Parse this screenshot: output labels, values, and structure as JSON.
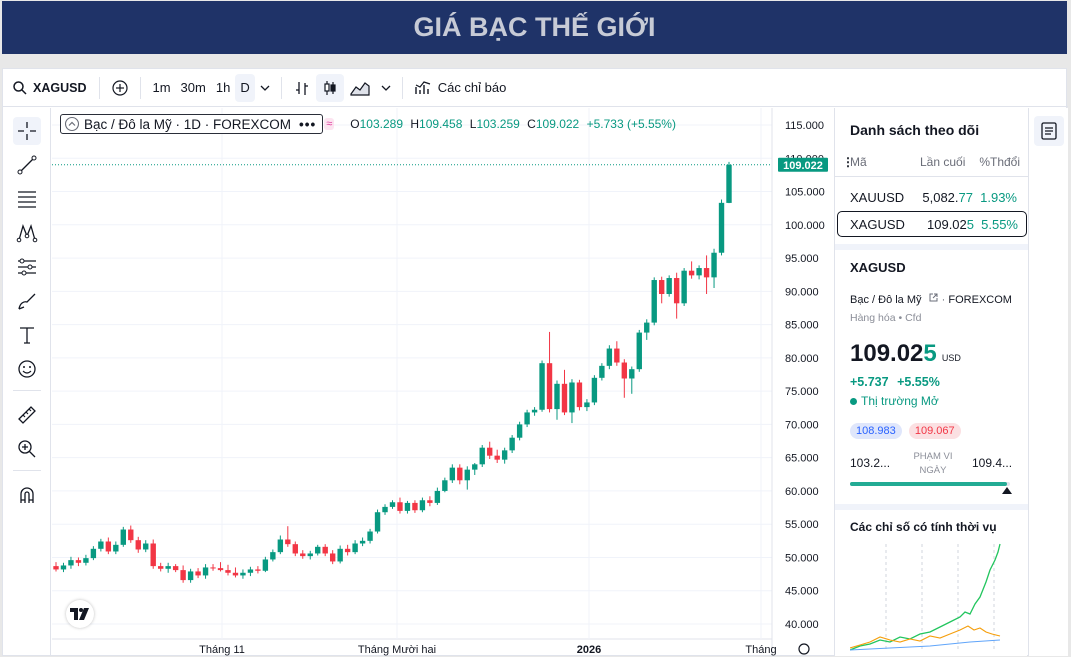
{
  "page": {
    "banner_title": "GIÁ BẠC THẾ GIỚI"
  },
  "toolbar": {
    "symbol": "XAGUSD",
    "intervals": [
      "1m",
      "30m",
      "1h",
      "D"
    ],
    "indicators_label": "Các chỉ báo"
  },
  "legend": {
    "title": "Bạc / Đô la Mỹ · 1D · FOREXCOM",
    "o_label": "O",
    "o": "103.289",
    "h_label": "H",
    "h": "109.458",
    "l_label": "L",
    "l": "103.259",
    "c_label": "C",
    "c": "109.022",
    "change": "+5.733 (+5.55%)"
  },
  "chart_data": {
    "type": "candlestick",
    "symbol": "XAGUSD",
    "ylim": [
      40,
      115
    ],
    "y_ticks": [
      "115.000",
      "110.000",
      "105.000",
      "100.000",
      "95.000",
      "90.000",
      "85.000",
      "80.000",
      "75.000",
      "70.000",
      "65.000",
      "60.000",
      "55.000",
      "50.000",
      "45.000",
      "40.000"
    ],
    "x_ticks": [
      "Tháng 11",
      "Tháng Mười hai",
      "2026",
      "Tháng"
    ],
    "last_price_label": "109.022",
    "last_price": 109.022,
    "colors": {
      "up": "#089981",
      "down": "#f23645"
    },
    "candles": [
      {
        "o": 48.7,
        "h": 49.3,
        "l": 47.9,
        "c": 48.2
      },
      {
        "o": 48.2,
        "h": 49.2,
        "l": 47.8,
        "c": 48.8
      },
      {
        "o": 48.8,
        "h": 50.1,
        "l": 48.3,
        "c": 49.6
      },
      {
        "o": 49.6,
        "h": 50.0,
        "l": 48.7,
        "c": 49.2
      },
      {
        "o": 49.2,
        "h": 50.4,
        "l": 48.8,
        "c": 49.9
      },
      {
        "o": 49.9,
        "h": 51.7,
        "l": 49.6,
        "c": 51.3
      },
      {
        "o": 51.3,
        "h": 52.8,
        "l": 50.9,
        "c": 52.4
      },
      {
        "o": 52.4,
        "h": 53.0,
        "l": 50.5,
        "c": 50.9
      },
      {
        "o": 50.9,
        "h": 52.4,
        "l": 50.5,
        "c": 51.9
      },
      {
        "o": 51.9,
        "h": 54.6,
        "l": 51.6,
        "c": 54.2
      },
      {
        "o": 54.2,
        "h": 54.8,
        "l": 52.2,
        "c": 52.6
      },
      {
        "o": 52.6,
        "h": 53.1,
        "l": 50.7,
        "c": 51.2
      },
      {
        "o": 51.2,
        "h": 52.6,
        "l": 50.8,
        "c": 52.1
      },
      {
        "o": 52.1,
        "h": 52.7,
        "l": 48.3,
        "c": 48.7
      },
      {
        "o": 48.7,
        "h": 49.2,
        "l": 47.9,
        "c": 48.3
      },
      {
        "o": 48.3,
        "h": 49.2,
        "l": 47.7,
        "c": 48.7
      },
      {
        "o": 48.7,
        "h": 49.0,
        "l": 47.8,
        "c": 48.1
      },
      {
        "o": 48.1,
        "h": 48.8,
        "l": 46.2,
        "c": 46.6
      },
      {
        "o": 46.6,
        "h": 48.3,
        "l": 46.2,
        "c": 47.9
      },
      {
        "o": 47.9,
        "h": 48.4,
        "l": 46.9,
        "c": 47.3
      },
      {
        "o": 47.3,
        "h": 49.0,
        "l": 46.8,
        "c": 48.5
      },
      {
        "o": 48.5,
        "h": 49.0,
        "l": 48.0,
        "c": 48.4
      },
      {
        "o": 48.4,
        "h": 49.3,
        "l": 47.9,
        "c": 48.1
      },
      {
        "o": 48.1,
        "h": 48.9,
        "l": 47.3,
        "c": 47.7
      },
      {
        "o": 47.7,
        "h": 48.5,
        "l": 47.0,
        "c": 47.3
      },
      {
        "o": 47.3,
        "h": 48.2,
        "l": 46.8,
        "c": 47.7
      },
      {
        "o": 47.7,
        "h": 48.6,
        "l": 47.2,
        "c": 48.2
      },
      {
        "o": 48.2,
        "h": 48.7,
        "l": 47.6,
        "c": 48.0
      },
      {
        "o": 48.0,
        "h": 50.1,
        "l": 47.8,
        "c": 49.7
      },
      {
        "o": 49.7,
        "h": 51.2,
        "l": 49.4,
        "c": 50.8
      },
      {
        "o": 50.8,
        "h": 53.3,
        "l": 50.5,
        "c": 52.7
      },
      {
        "o": 52.7,
        "h": 54.7,
        "l": 51.6,
        "c": 52.0
      },
      {
        "o": 52.0,
        "h": 52.4,
        "l": 50.2,
        "c": 50.6
      },
      {
        "o": 50.6,
        "h": 51.1,
        "l": 49.8,
        "c": 50.2
      },
      {
        "o": 50.2,
        "h": 51.0,
        "l": 49.7,
        "c": 50.6
      },
      {
        "o": 50.6,
        "h": 51.9,
        "l": 50.3,
        "c": 51.6
      },
      {
        "o": 51.6,
        "h": 52.0,
        "l": 50.2,
        "c": 50.6
      },
      {
        "o": 50.6,
        "h": 51.1,
        "l": 49.0,
        "c": 49.4
      },
      {
        "o": 49.4,
        "h": 51.8,
        "l": 49.1,
        "c": 51.3
      },
      {
        "o": 51.3,
        "h": 51.9,
        "l": 50.3,
        "c": 50.8
      },
      {
        "o": 50.8,
        "h": 52.6,
        "l": 50.5,
        "c": 52.1
      },
      {
        "o": 52.1,
        "h": 53.0,
        "l": 51.7,
        "c": 52.5
      },
      {
        "o": 52.5,
        "h": 54.3,
        "l": 52.1,
        "c": 53.9
      },
      {
        "o": 53.9,
        "h": 57.2,
        "l": 53.6,
        "c": 56.8
      },
      {
        "o": 56.8,
        "h": 58.0,
        "l": 56.4,
        "c": 57.6
      },
      {
        "o": 57.6,
        "h": 58.6,
        "l": 57.3,
        "c": 58.3
      },
      {
        "o": 58.3,
        "h": 59.0,
        "l": 56.6,
        "c": 57.0
      },
      {
        "o": 57.0,
        "h": 58.5,
        "l": 56.6,
        "c": 58.2
      },
      {
        "o": 58.2,
        "h": 58.6,
        "l": 56.7,
        "c": 57.1
      },
      {
        "o": 57.1,
        "h": 59.0,
        "l": 56.8,
        "c": 58.6
      },
      {
        "o": 58.6,
        "h": 59.2,
        "l": 57.7,
        "c": 58.2
      },
      {
        "o": 58.2,
        "h": 60.5,
        "l": 57.9,
        "c": 60.0
      },
      {
        "o": 60.0,
        "h": 62.0,
        "l": 59.8,
        "c": 61.6
      },
      {
        "o": 61.6,
        "h": 64.0,
        "l": 61.2,
        "c": 63.5
      },
      {
        "o": 63.5,
        "h": 64.0,
        "l": 61.0,
        "c": 61.6
      },
      {
        "o": 61.6,
        "h": 63.7,
        "l": 60.2,
        "c": 63.2
      },
      {
        "o": 63.2,
        "h": 64.2,
        "l": 62.4,
        "c": 64.0
      },
      {
        "o": 64.0,
        "h": 66.9,
        "l": 63.6,
        "c": 66.5
      },
      {
        "o": 66.5,
        "h": 67.4,
        "l": 64.8,
        "c": 65.3
      },
      {
        "o": 65.3,
        "h": 66.2,
        "l": 64.2,
        "c": 64.7
      },
      {
        "o": 64.7,
        "h": 66.5,
        "l": 64.1,
        "c": 66.1
      },
      {
        "o": 66.1,
        "h": 68.4,
        "l": 65.7,
        "c": 68.0
      },
      {
        "o": 68.0,
        "h": 70.4,
        "l": 67.6,
        "c": 70.0
      },
      {
        "o": 70.0,
        "h": 72.2,
        "l": 69.6,
        "c": 71.8
      },
      {
        "o": 71.8,
        "h": 72.6,
        "l": 71.3,
        "c": 72.2
      },
      {
        "o": 72.2,
        "h": 79.6,
        "l": 71.9,
        "c": 79.2
      },
      {
        "o": 79.2,
        "h": 83.9,
        "l": 71.8,
        "c": 72.3
      },
      {
        "o": 72.3,
        "h": 76.6,
        "l": 70.7,
        "c": 76.1
      },
      {
        "o": 76.1,
        "h": 78.2,
        "l": 71.4,
        "c": 71.8
      },
      {
        "o": 71.8,
        "h": 76.8,
        "l": 70.2,
        "c": 76.3
      },
      {
        "o": 76.3,
        "h": 76.7,
        "l": 72.1,
        "c": 72.6
      },
      {
        "o": 72.6,
        "h": 73.8,
        "l": 72.0,
        "c": 73.3
      },
      {
        "o": 73.3,
        "h": 77.4,
        "l": 72.9,
        "c": 77.0
      },
      {
        "o": 77.0,
        "h": 79.2,
        "l": 76.6,
        "c": 78.8
      },
      {
        "o": 78.8,
        "h": 81.9,
        "l": 78.3,
        "c": 81.4
      },
      {
        "o": 81.4,
        "h": 82.5,
        "l": 78.8,
        "c": 79.3
      },
      {
        "o": 79.3,
        "h": 79.8,
        "l": 74.0,
        "c": 76.9
      },
      {
        "o": 76.9,
        "h": 78.7,
        "l": 74.6,
        "c": 78.3
      },
      {
        "o": 78.3,
        "h": 84.2,
        "l": 77.9,
        "c": 83.8
      },
      {
        "o": 83.8,
        "h": 85.8,
        "l": 82.7,
        "c": 85.3
      },
      {
        "o": 85.3,
        "h": 92.1,
        "l": 84.9,
        "c": 91.7
      },
      {
        "o": 91.7,
        "h": 92.2,
        "l": 88.2,
        "c": 89.6
      },
      {
        "o": 89.6,
        "h": 92.4,
        "l": 89.2,
        "c": 92.0
      },
      {
        "o": 92.0,
        "h": 92.8,
        "l": 85.9,
        "c": 88.2
      },
      {
        "o": 88.2,
        "h": 93.5,
        "l": 87.8,
        "c": 93.1
      },
      {
        "o": 93.1,
        "h": 94.5,
        "l": 91.9,
        "c": 92.4
      },
      {
        "o": 92.4,
        "h": 93.9,
        "l": 91.8,
        "c": 93.5
      },
      {
        "o": 93.5,
        "h": 95.4,
        "l": 89.6,
        "c": 92.1
      },
      {
        "o": 92.1,
        "h": 96.4,
        "l": 90.5,
        "c": 95.8
      },
      {
        "o": 95.8,
        "h": 103.8,
        "l": 95.4,
        "c": 103.3
      },
      {
        "o": 103.289,
        "h": 109.458,
        "l": 103.259,
        "c": 109.022
      }
    ]
  },
  "watchlist": {
    "title": "Danh sách theo dõi",
    "columns": [
      "Mã",
      "Lần cuối",
      "%Thđổi"
    ],
    "rows": [
      {
        "symbol": "XAUUSD",
        "last_main": "5,082.",
        "last_tail": "77",
        "change": "1.93%"
      },
      {
        "symbol": "XAGUSD",
        "last_main": "109.02",
        "last_tail": "5",
        "change": "5.55%"
      }
    ]
  },
  "details": {
    "symbol": "XAGUSD",
    "description": "Bạc / Đô la Mỹ",
    "exchange": "FOREXCOM",
    "category": "Hàng hóa",
    "type": "Cfd",
    "price_main": "109.02",
    "price_tail": "5",
    "currency": "USD",
    "change_abs": "+5.737",
    "change_pct": "+5.55%",
    "market_status": "Thị trường Mở",
    "bid": "108.983",
    "ask": "109.067",
    "range_low": "103.2...",
    "range_label": "PHẠM VI NGÀY",
    "range_high": "109.4...",
    "range_position": 0.98,
    "seasonal_title": "Các chỉ số có tính thời vụ"
  }
}
